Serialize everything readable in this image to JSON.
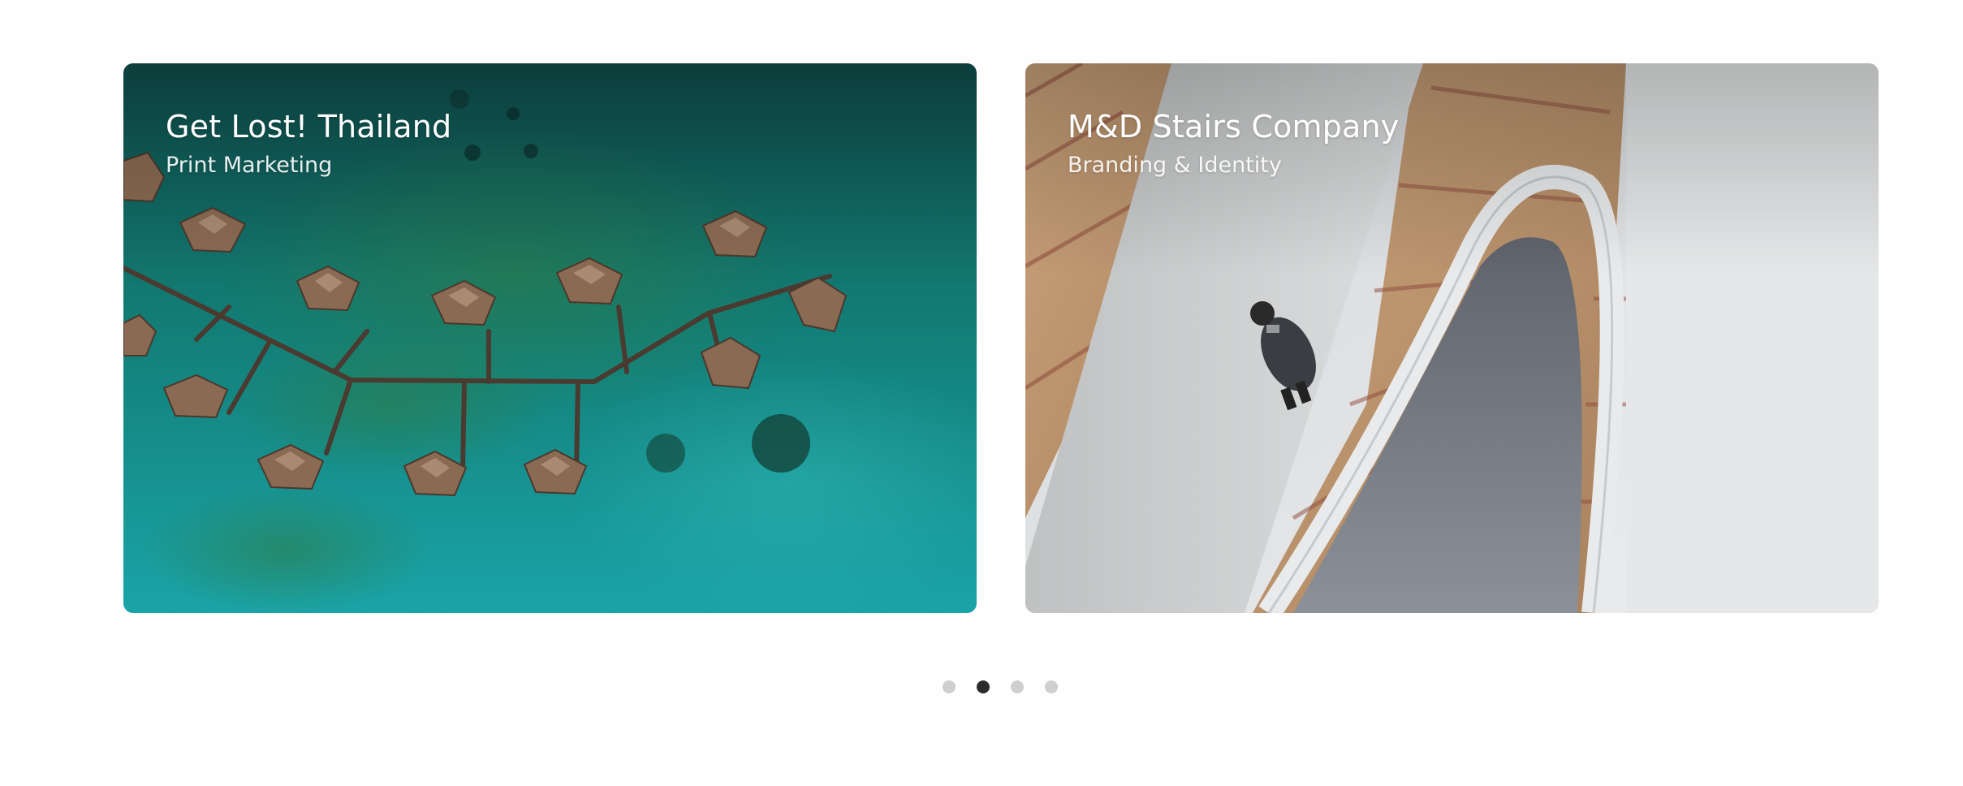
{
  "carousel": {
    "slides": [
      {
        "title": "Get Lost! Thailand",
        "subtitle": "Print Marketing",
        "image": "aerial-overwater-villas-image"
      },
      {
        "title": "M&D Stairs Company",
        "subtitle": "Branding & Identity",
        "image": "spiral-staircase-image"
      }
    ],
    "pagination": {
      "count": 4,
      "active_index": 1
    }
  },
  "colors": {
    "page_background": "#fefefe",
    "dot_inactive": "#cfcfcf",
    "dot_active": "#2b2b2b",
    "caption_text": "#ffffff"
  }
}
